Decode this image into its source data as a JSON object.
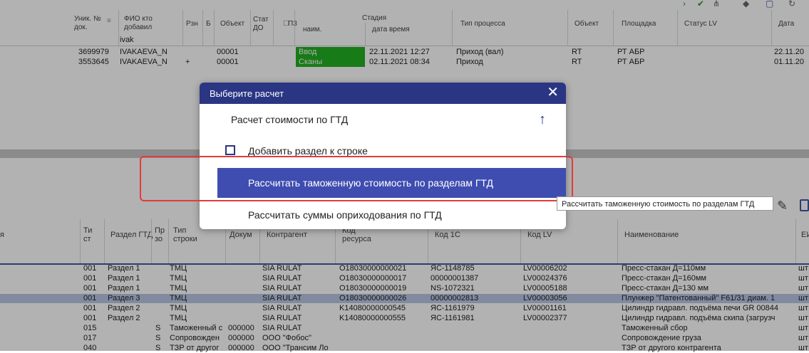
{
  "top_grid": {
    "headers": {
      "doc_no": "Уник. № док.",
      "fio": "ФИО кто добавил",
      "rzn": "Рзн",
      "b": "Б",
      "object": "Объект",
      "stat_do": "Стат ДО",
      "p3": "П3",
      "stage": "Стадия",
      "stage_name": "наим.",
      "stage_dt": "дата время",
      "process_type": "Тип процесса",
      "object2": "Объект",
      "site": "Площадка",
      "status_lv": "Статус LV",
      "date": "Дата"
    },
    "filter_value": "ivak",
    "rows": [
      {
        "doc_no": "3699979",
        "fio": "IVAKAEVA_N",
        "rzn": "",
        "object": "00001",
        "stage": "Ввод",
        "stage_dt": "22.11.2021 12:27",
        "process_type": "Приход (вал)",
        "object2": "RT",
        "site": "РТ АБР",
        "date": "22.11.20"
      },
      {
        "doc_no": "3553645",
        "fio": "IVAKAEVA_N",
        "rzn": "+",
        "object": "00001",
        "stage": "Сканы",
        "stage_dt": "02.11.2021 08:34",
        "process_type": "Приход",
        "object2": "RT",
        "site": "РТ АБР",
        "date": "01.11.20"
      }
    ]
  },
  "bottom_grid": {
    "headers": {
      "c0": "я",
      "tip_st": "Ти ст",
      "razdel": "Раздел ГТД",
      "pr": "Пр зо",
      "tip_str": "Тип строки",
      "docum": "Докум",
      "kontragent": "Контрагент",
      "kod_resursa": "Код ресурса",
      "kod1c": "Код 1С",
      "kodlv": "Код LV",
      "naim": "Наименование",
      "ei": "ЕИ"
    },
    "rows": [
      {
        "tip": "001",
        "razdel": "Раздел 1",
        "pr": "",
        "tipstr": "ТМЦ",
        "doc": "",
        "kontr": "SIA RULAT",
        "res": "О18030000000021",
        "k1c": "ЯС-1148785",
        "klv": "LV00006202",
        "naim": "Пресс-стакан Д=110мм",
        "ei": "шт"
      },
      {
        "tip": "001",
        "razdel": "Раздел 1",
        "pr": "",
        "tipstr": "ТМЦ",
        "doc": "",
        "kontr": "SIA RULAT",
        "res": "О18030000000017",
        "k1c": "00000001387",
        "klv": "LV00024376",
        "naim": "Пресс-стакан Д=160мм",
        "ei": "шт"
      },
      {
        "tip": "001",
        "razdel": "Раздел 1",
        "pr": "",
        "tipstr": "ТМЦ",
        "doc": "",
        "kontr": "SIA RULAT",
        "res": "О18030000000019",
        "k1c": "NS-1072321",
        "klv": "LV00005188",
        "naim": "Пресс-стакан Д=130 мм",
        "ei": "шт"
      },
      {
        "tip": "001",
        "razdel": "Раздел 3",
        "pr": "",
        "tipstr": "ТМЦ",
        "doc": "",
        "kontr": "SIA RULAT",
        "res": "О18030000000026",
        "k1c": "00000002813",
        "klv": "LV00003056",
        "naim": "Плунжер \"Патентованный\" F61/31 диам. 1",
        "ei": "шт"
      },
      {
        "tip": "001",
        "razdel": "Раздел 2",
        "pr": "",
        "tipstr": "ТМЦ",
        "doc": "",
        "kontr": "SIA RULAT",
        "res": "K14080000000545",
        "k1c": "ЯС-1161979",
        "klv": "LV00001161",
        "naim": "Цилиндр гидравл. подъёма печи GR 00844",
        "ei": "шт"
      },
      {
        "tip": "001",
        "razdel": "Раздел 2",
        "pr": "",
        "tipstr": "ТМЦ",
        "doc": "",
        "kontr": "SIA RULAT",
        "res": "K14080000000555",
        "k1c": "ЯС-1161981",
        "klv": "LV00002377",
        "naim": "Цилиндр гидравл. подъёма скипа (загрузч",
        "ei": "шт"
      },
      {
        "tip": "015",
        "razdel": "",
        "pr": "S",
        "tipstr": "Таможенный с",
        "doc": "000000",
        "kontr": "SIA RULAT",
        "res": "",
        "k1c": "",
        "klv": "",
        "naim": "Таможенный сбор",
        "ei": "шт"
      },
      {
        "tip": "017",
        "razdel": "",
        "pr": "S",
        "tipstr": "Сопровожден",
        "doc": "000000",
        "kontr": "ООО \"Фобос\"",
        "res": "",
        "k1c": "",
        "klv": "",
        "naim": "Сопровождение груза",
        "ei": "шт"
      },
      {
        "tip": "040",
        "razdel": "",
        "pr": "S",
        "tipstr": "ТЗР от другог",
        "doc": "000000",
        "kontr": "ООО \"Трансим Ло",
        "res": "",
        "k1c": "",
        "klv": "",
        "naim": "ТЗР от другого контрагента",
        "ei": "шт"
      }
    ]
  },
  "dialog": {
    "title": "Выберите расчет",
    "items": [
      {
        "label": "Расчет стоимости по ГТД"
      },
      {
        "label": "Добавить раздел к строке"
      },
      {
        "label": "Рассчитать таможенную стоимость по разделам ГТД"
      },
      {
        "label": "Рассчитать суммы оприходования по ГТД"
      }
    ]
  },
  "tooltip": {
    "text": "Рассчитать таможенную стоимость по разделам ГТД"
  },
  "colors": {
    "dialog_header": "#2a3684",
    "selected_item": "#3f4db0",
    "stage_green": "#22b022",
    "highlight_border": "#e53a3a"
  },
  "icons": [
    "check-icon",
    "tree-icon",
    "diamond-icon",
    "doc-icon",
    "refresh-icon",
    "close-icon",
    "arrow-up-icon",
    "copy-icon",
    "pencil-icon"
  ]
}
